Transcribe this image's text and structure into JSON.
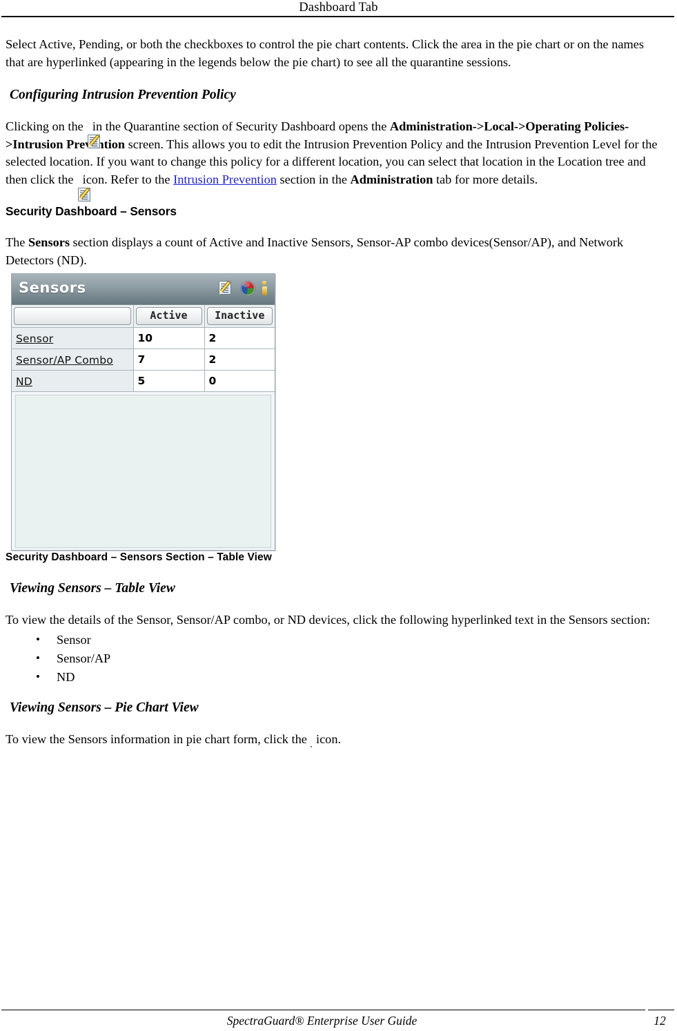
{
  "header": {
    "title": "Dashboard Tab"
  },
  "intro": {
    "paragraph": "Select Active, Pending, or both the checkboxes to control the pie chart contents. Click the area in the pie chart or on the names that are hyperlinked (appearing in the legends below the pie chart) to see all the quarantine sessions."
  },
  "section_intrusion": {
    "heading": "Configuring Intrusion Prevention Policy",
    "text_1": "Clicking on the ",
    "text_2": " in the Quarantine section of Security Dashboard opens the ",
    "bold_1": "Administration->Local->Operating Policies->Intrusion Prevention",
    "text_3": " screen. This allows you to edit the Intrusion Prevention Policy and the Intrusion Prevention Level for the selected location. If you want to change this policy for a different location, you can select that location in the Location tree and then click the ",
    "text_4": " icon. Refer to the ",
    "link_text": "Intrusion Prevention",
    "text_5": " section in the ",
    "bold_2": "Administration",
    "text_6": " tab for more details."
  },
  "section_sensors": {
    "heading": "Security Dashboard – Sensors",
    "text_1": "The ",
    "bold_1": "Sensors",
    "text_2": " section displays a count of Active and Inactive Sensors, Sensor-AP combo devices(Sensor/AP), and Network Detectors (ND).",
    "figure_caption": "Security Dashboard – Sensors Section – Table View"
  },
  "widget": {
    "title": "Sensors",
    "actions": [
      {
        "name": "edit-icon",
        "label": "Edit"
      },
      {
        "name": "pie-chart-icon",
        "label": "Pie Chart View"
      },
      {
        "name": "info-icon",
        "label": "Information"
      }
    ],
    "table": {
      "columns": [
        "",
        "Active",
        "Inactive"
      ],
      "rows": [
        {
          "label": "Sensor",
          "active": "10",
          "inactive": "2"
        },
        {
          "label": "Sensor/AP Combo",
          "active": "7",
          "inactive": "2"
        },
        {
          "label": "ND",
          "active": "5",
          "inactive": "0"
        }
      ]
    },
    "colors": {
      "titlebar_top": "#a9b5ba",
      "titlebar_bottom": "#67777f",
      "label_cell_bg": "#e8eef0",
      "blank_panel_bg": "#eaf1f1"
    }
  },
  "section_table_view": {
    "heading": "Viewing Sensors – Table View",
    "paragraph": "To view the details of the Sensor, Sensor/AP combo, or ND devices, click the following hyperlinked text in the Sensors section:",
    "bullets": [
      "Sensor",
      "Sensor/AP",
      "ND"
    ]
  },
  "section_pie_view": {
    "heading": "Viewing Sensors – Pie Chart View",
    "text_1": "To view the Sensors information in pie chart form, click the ",
    "text_2": " icon."
  },
  "footer": {
    "guide_title": "SpectraGuard® Enterprise User Guide",
    "page_number": "12"
  }
}
